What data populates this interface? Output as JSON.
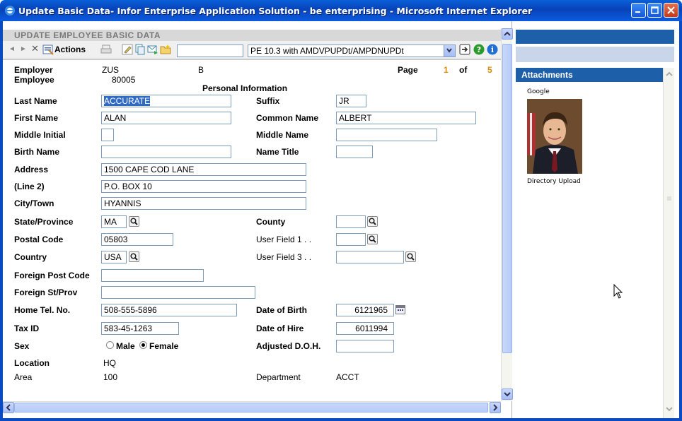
{
  "window": {
    "title": "Update Basic Data- Infor Enterprise Application Solution - be enterprising - Microsoft Internet Explorer"
  },
  "header": {
    "title": "UPDATE EMPLOYEE BASIC DATA"
  },
  "toolbar": {
    "actions_label": "Actions",
    "search_value": "",
    "program_select": "PE 10.3 with AMDVPUPDt/AMPDNUPDt"
  },
  "record": {
    "employer_label": "Employer",
    "employer_value": "ZUS",
    "employer_suffix": "B",
    "employee_label": "Employee",
    "employee_value": "80005",
    "page_label": "Page",
    "page_num": "1",
    "of_label": "of",
    "page_total": "5",
    "section_title": "Personal Information"
  },
  "fields": {
    "last_name_label": "Last Name",
    "last_name": "ACCURATE",
    "suffix_label": "Suffix",
    "suffix": "JR",
    "first_name_label": "First Name",
    "first_name": "ALAN",
    "common_name_label": "Common Name",
    "common_name": "ALBERT",
    "middle_initial_label": "Middle Initial",
    "middle_initial": "",
    "middle_name_label": "Middle Name",
    "middle_name": "",
    "birth_name_label": "Birth Name",
    "birth_name": "",
    "name_title_label": "Name Title",
    "name_title": "",
    "address_label": "Address",
    "address": "1500 CAPE COD LANE",
    "line2_label": "(Line 2)",
    "line2": "P.O. BOX 10",
    "city_label": "City/Town",
    "city": "HYANNIS",
    "state_label": "State/Province",
    "state": "MA",
    "county_label": "County",
    "county": "",
    "postal_label": "Postal Code",
    "postal": "05803",
    "user1_label": "User Field 1  . .",
    "user1": "",
    "country_label": "Country",
    "country": "USA",
    "user3_label": "User Field 3  . .",
    "user3": "",
    "foreign_post_label": "Foreign Post Code",
    "foreign_post": "",
    "foreign_st_label": "Foreign St/Prov",
    "foreign_st": "",
    "home_tel_label": "Home Tel. No.",
    "home_tel": "508-555-5896",
    "dob_label": "Date of Birth",
    "dob": "6121965",
    "tax_label": "Tax ID",
    "tax": "583-45-1263",
    "doh_label": "Date of Hire",
    "doh": "6011994",
    "sex_label": "Sex",
    "sex_male": "Male",
    "sex_female": "Female",
    "adj_doh_label": "Adjusted D.O.H.",
    "adj_doh": "",
    "location_label": "Location",
    "location": "HQ",
    "area_label": "Area",
    "area": "100",
    "department_label": "Department",
    "department": "ACCT"
  },
  "attachments": {
    "header": "Attachments",
    "source_label": "Google",
    "caption": "Directory Upload"
  }
}
